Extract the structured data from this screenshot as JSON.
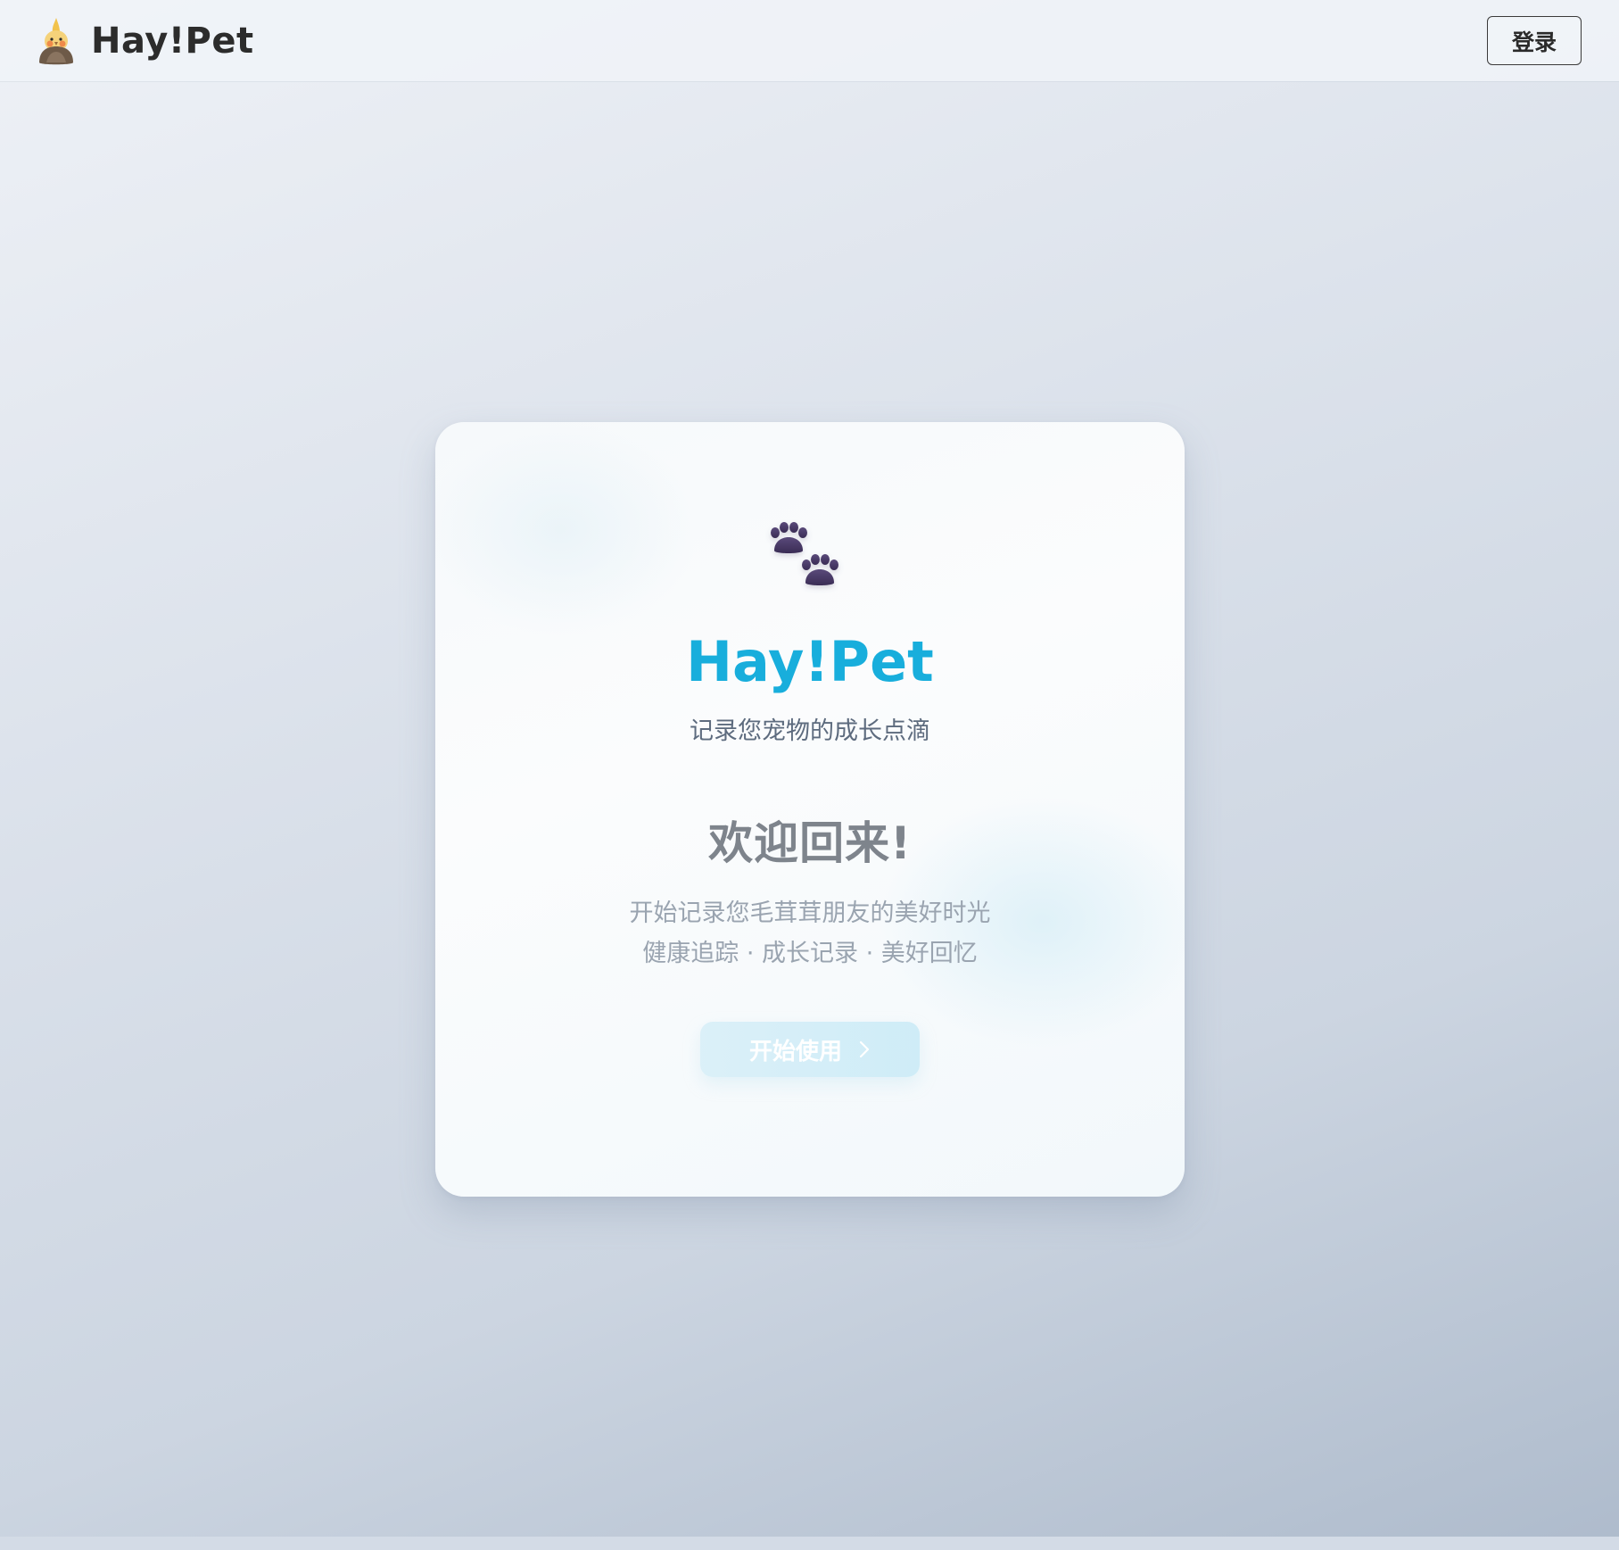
{
  "header": {
    "brand_name": "Hay!Pet",
    "brand_logo_icon": "cockatiel-bird-icon",
    "login_label": "登录"
  },
  "card": {
    "icon": "paw-prints-icon",
    "icon_color": "#4a3a66",
    "title": "Hay!Pet",
    "title_color": "#18aedc",
    "subtitle": "记录您宠物的成长点滴",
    "welcome": "欢迎回来!",
    "description_line1": "开始记录您毛茸茸朋友的美好时光",
    "description_line2": "健康追踪 · 成长记录 · 美好回忆",
    "start_button_label": "开始使用",
    "start_button_icon": "chevron-right-icon"
  }
}
